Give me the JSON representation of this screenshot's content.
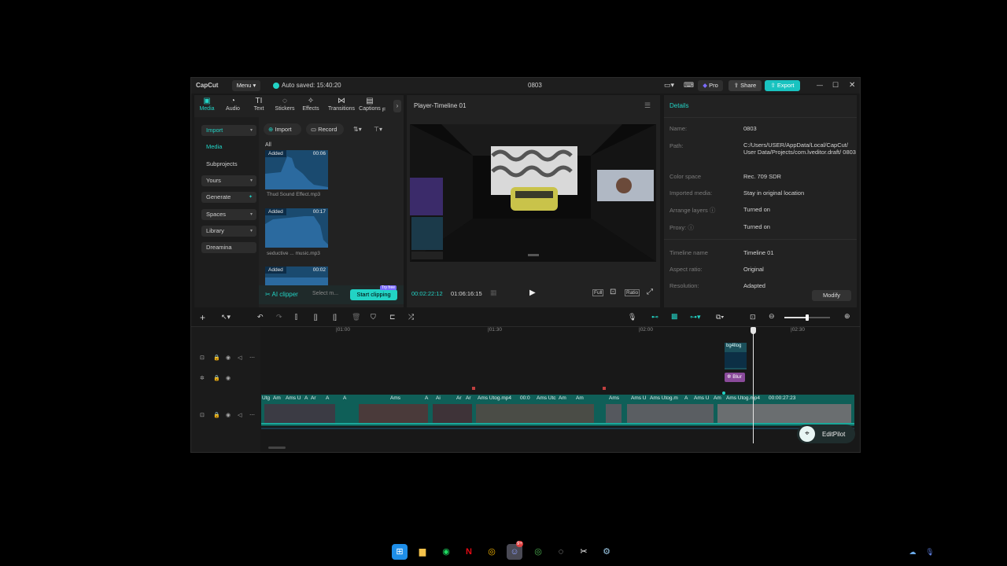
{
  "colors": {
    "accent": "#22d3c5",
    "export_bg": "#19c3c0",
    "pro": "#7b6cff",
    "clip": "#0f5f58"
  },
  "titlebar": {
    "app_name": "CapCut",
    "menu_label": "Menu",
    "autosave": "Auto saved: 15:40:20",
    "project_title": "0803",
    "pro_label": "Pro",
    "share_label": "Share",
    "export_label": "Export"
  },
  "toolbar": {
    "tabs": [
      {
        "label": "Media",
        "icon": "media-icon"
      },
      {
        "label": "Audio",
        "icon": "audio-icon"
      },
      {
        "label": "Text",
        "icon": "text-icon"
      },
      {
        "label": "Stickers",
        "icon": "stickers-icon"
      },
      {
        "label": "Effects",
        "icon": "effects-icon"
      },
      {
        "label": "Transitions",
        "icon": "transitions-icon"
      },
      {
        "label": "Captions",
        "icon": "captions-icon"
      }
    ],
    "truncated_tab": "F"
  },
  "sidebar": {
    "items": [
      {
        "label": "Import"
      },
      {
        "label": "Media"
      },
      {
        "label": "Subprojects"
      },
      {
        "label": "Yours"
      },
      {
        "label": "Generate"
      },
      {
        "label": "Spaces"
      },
      {
        "label": "Library"
      },
      {
        "label": "Dreamina"
      }
    ]
  },
  "media": {
    "import_label": "Import",
    "record_label": "Record",
    "filter_all": "All",
    "cards": [
      {
        "tag": "Added",
        "duration": "00:06",
        "name": "Thud Sound Effect.mp3"
      },
      {
        "tag": "Added",
        "duration": "00:17",
        "name": "seductive ... music.mp3"
      },
      {
        "tag": "Added",
        "duration": "00:02",
        "name": ""
      }
    ],
    "ai_clipper": "AI clipper",
    "select_placeholder": "Select m...",
    "start_clipping": "Start clipping",
    "try_free": "Try free"
  },
  "player": {
    "title": "Player-Timeline 01",
    "current_time": "00:02:22:12",
    "total_time": "01:06:16:15",
    "full_label": "Full",
    "ratio_label": "Ratio"
  },
  "details": {
    "title": "Details",
    "rows": [
      {
        "label": "Name:",
        "value": "0803"
      },
      {
        "label": "Path:",
        "value": "C:/Users/USER/AppData/Local/CapCut/ User Data/Projects/com.lveditor.draft/ 0803"
      },
      {
        "label": "Color space",
        "value": "Rec. 709 SDR"
      },
      {
        "label": "Imported media:",
        "value": "Stay in original location"
      },
      {
        "label": "Arrange layers",
        "value": "Turned on"
      },
      {
        "label": "Proxy:",
        "value": "Turned on"
      },
      {
        "label": "Timeline name",
        "value": "Timeline 01"
      },
      {
        "label": "Aspect ratio:",
        "value": "Original"
      },
      {
        "label": "Resolution:",
        "value": "Adapted"
      }
    ],
    "modify_label": "Modify"
  },
  "timeline": {
    "ruler": [
      "|01:00",
      "|01:30",
      "|02:00",
      "|02:30"
    ],
    "overlay_clip_label": "bg4llog",
    "blur_label": "Blur",
    "main_clip_labels": [
      "Utg",
      "Am",
      "Ams U",
      "A",
      "Ar",
      "A",
      "A",
      "Ams",
      "A",
      "Ai",
      "Ar",
      "Ar",
      "Ams Utog.mp4",
      "00:0",
      "Ams Utc",
      "Am",
      "Am",
      "Ams",
      "Ams U",
      "Ams Utog.m",
      "A",
      "Ams U",
      "Am",
      "Ams Utog.mp4",
      "00:00:27:23"
    ],
    "editpilot_label": "EditPilot"
  },
  "taskbar": {
    "icons": [
      "windows-start-icon",
      "file-explorer-icon",
      "spotify-icon",
      "netflix-icon",
      "chrome-icon",
      "discord-icon",
      "chrome-profile-icon",
      "obs-icon",
      "capcut-icon",
      "steam-icon"
    ],
    "discord_badge": "9+"
  }
}
